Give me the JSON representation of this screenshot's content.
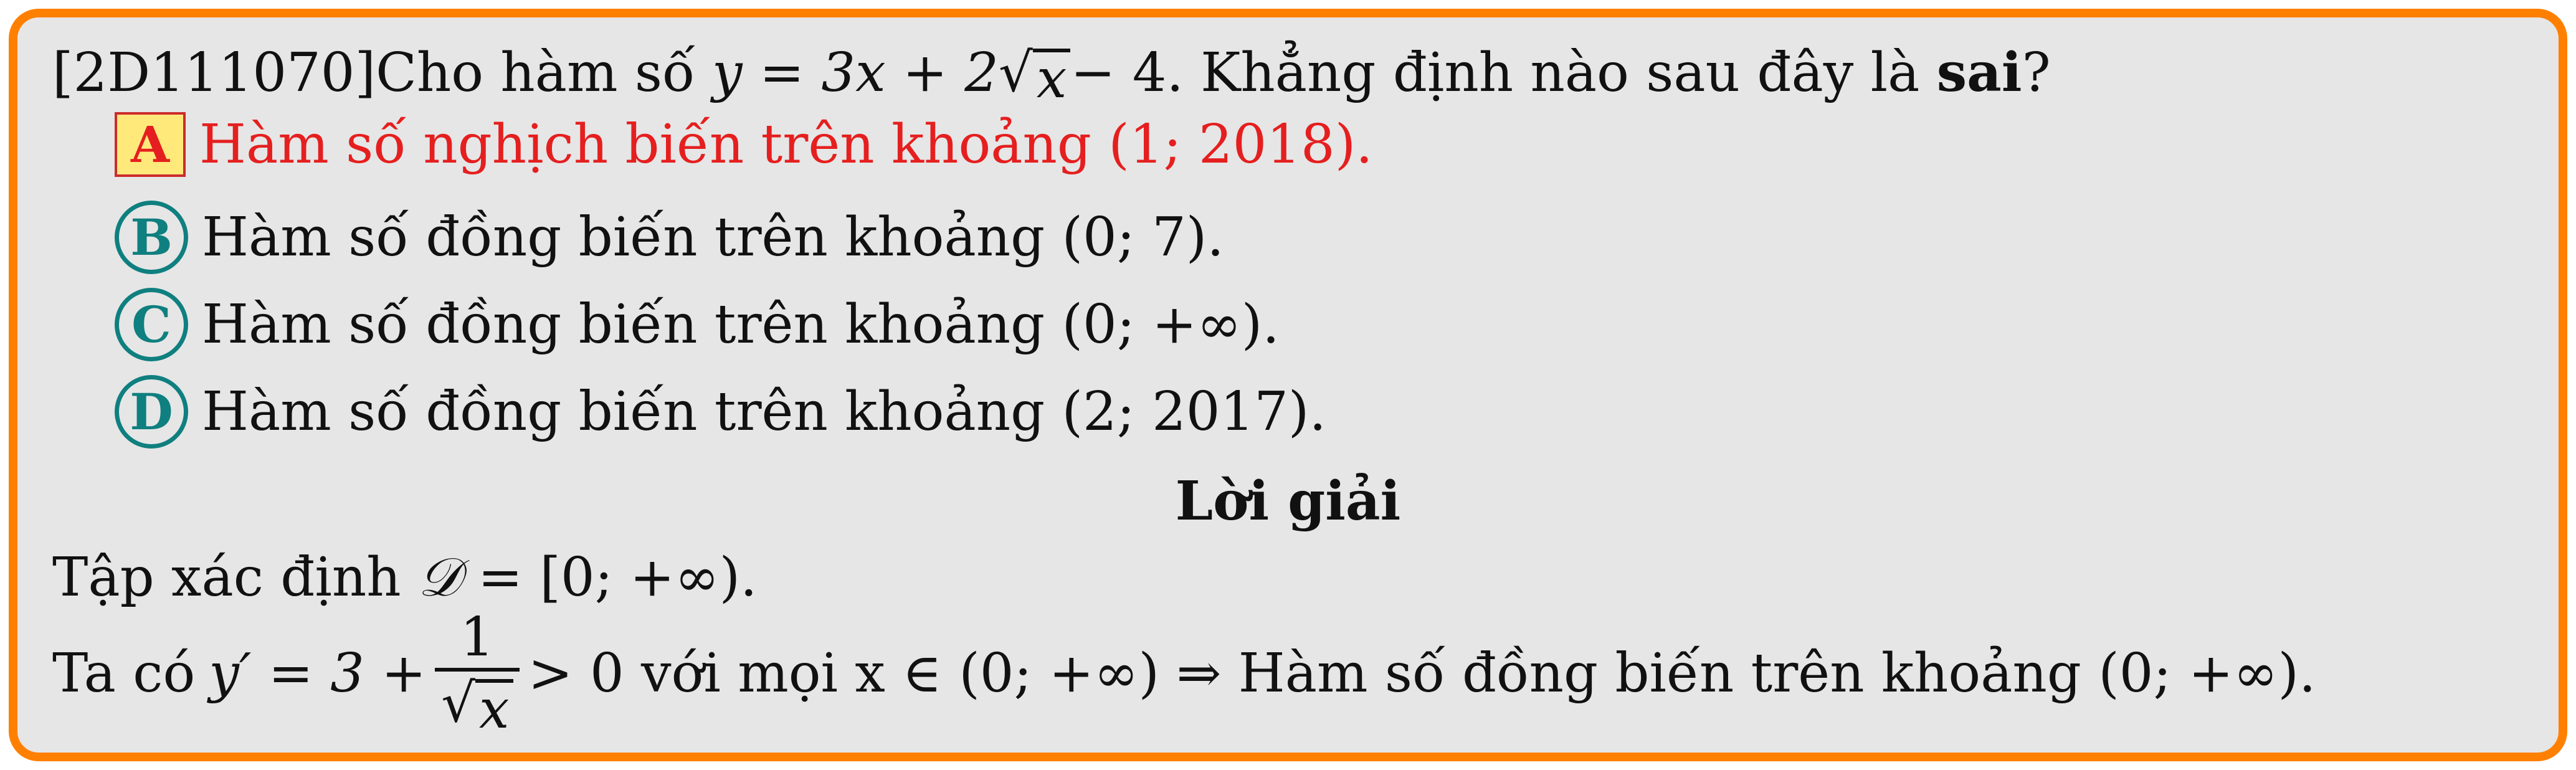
{
  "question": {
    "code": "[2D111070]",
    "lead": "Cho hàm số",
    "function_lhs": "y = 3x + 2",
    "function_radicand": "x",
    "function_tail": " − 4.",
    "prompt": "Khẳng định nào sau đây là",
    "emphasis": "sai",
    "end": "?"
  },
  "options": [
    {
      "letter": "A",
      "text": "Hàm số nghịch biến trên khoảng (1; 2018).",
      "correct": true
    },
    {
      "letter": "B",
      "text": "Hàm số đồng biến trên khoảng (0; 7).",
      "correct": false
    },
    {
      "letter": "C",
      "text": "Hàm số đồng biến trên khoảng (0; +∞).",
      "correct": false
    },
    {
      "letter": "D",
      "text": "Hàm số đồng biến trên khoảng (2; 2017).",
      "correct": false
    }
  ],
  "solution": {
    "heading": "Lời giải",
    "domain_prefix": "Tập xác định",
    "domain_symbol": "𝒟",
    "domain_value": " = [0; +∞).",
    "derivative_prefix": "Ta có",
    "derivative_lhs": "y′ = 3 +",
    "frac_numerator": "1",
    "frac_radicand": "x",
    "derivative_tail": "> 0 với mọi x ∈ (0; +∞) ⇒ Hàm số đồng biến trên khoảng (0; +∞)."
  },
  "colors": {
    "frame": "#ff8000",
    "background": "#e6e6e6",
    "correct": "#e51f1f",
    "marker": "#0f7f7f",
    "highlight": "#ffe97a"
  }
}
